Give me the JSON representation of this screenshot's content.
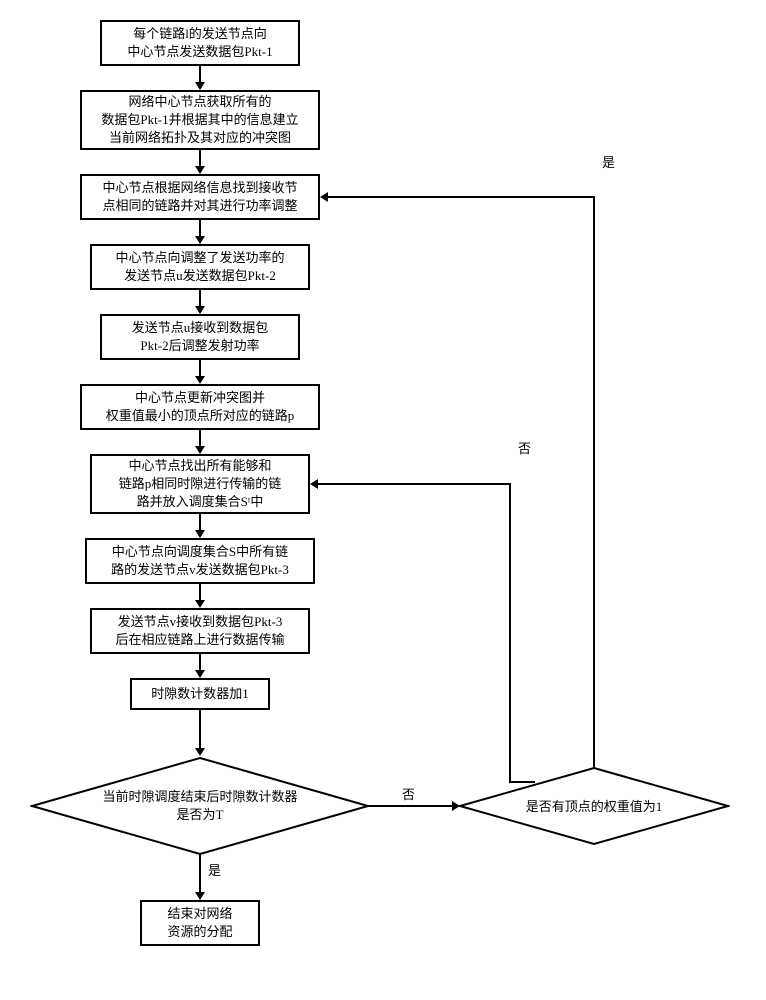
{
  "nodes": {
    "n1": "每个链路l的发送节点向\n中心节点发送数据包Pkt-1",
    "n2": "网络中心节点获取所有的\n数据包Pkt-1并根据其中的信息建立\n当前网络拓扑及其对应的冲突图",
    "n3": "中心节点根据网络信息找到接收节\n点相同的链路并对其进行功率调整",
    "n4": "中心节点向调整了发送功率的\n发送节点u发送数据包Pkt-2",
    "n5": "发送节点u接收到数据包\nPkt-2后调整发射功率",
    "n6": "中心节点更新冲突图并\n权重值最小的顶点所对应的链路p",
    "n7": "中心节点找出所有能够和\n链路p相同时隙进行传输的链\n路并放入调度集合Sᵗ中",
    "n8": "中心节点向调度集合S中所有链\n路的发送节点v发送数据包Pkt-3",
    "n9": "发送节点v接收到数据包Pkt-3\n后在相应链路上进行数据传输",
    "n10": "时隙数计数器加1",
    "d1": "当前时隙调度结束后时隙数计数器\n是否为T",
    "d2": "是否有顶点的权重值为1",
    "n11": "结束对网络\n资源的分配"
  },
  "labels": {
    "yes": "是",
    "no": "否"
  }
}
